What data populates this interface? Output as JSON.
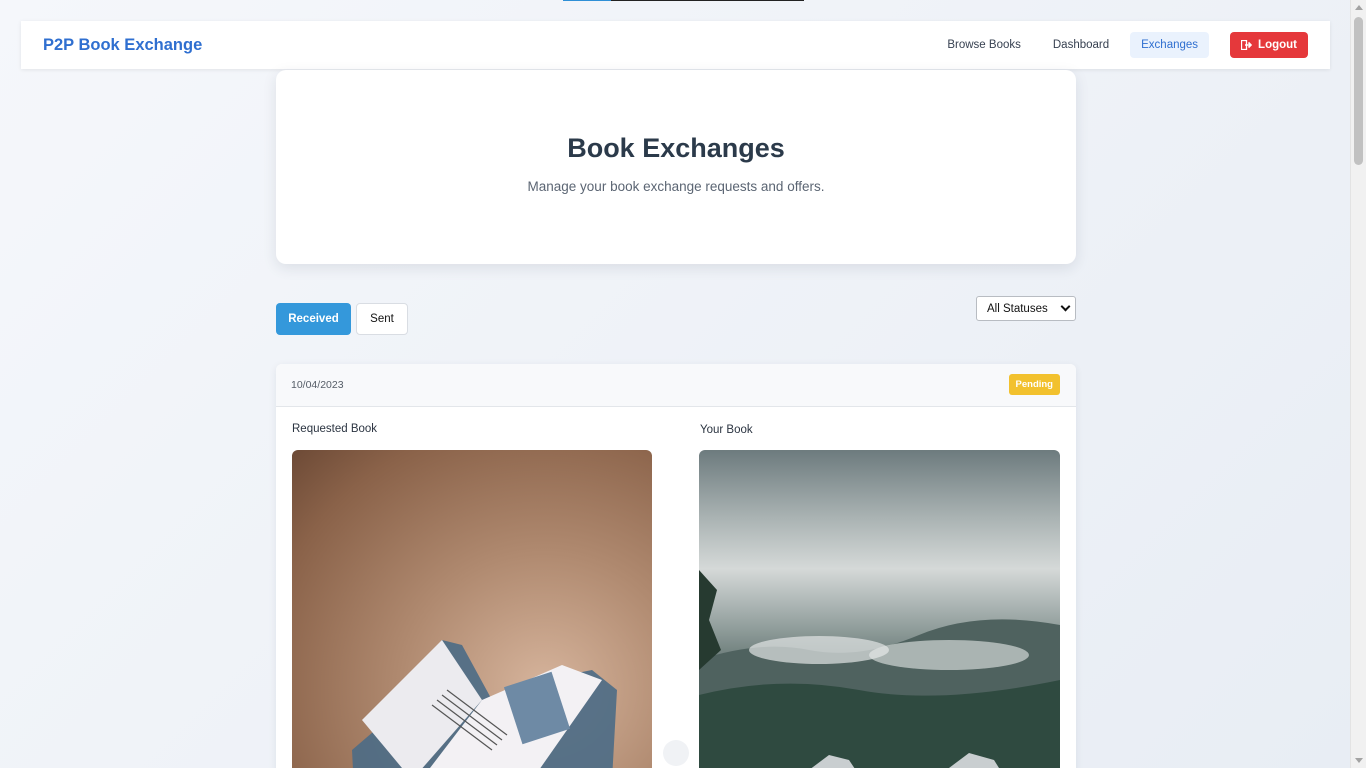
{
  "navbar": {
    "brand": "P2P Book Exchange",
    "links": [
      {
        "label": "Browse Books",
        "active": false
      },
      {
        "label": "Dashboard",
        "active": false
      },
      {
        "label": "Exchanges",
        "active": true
      }
    ],
    "logout_label": "Logout",
    "logout_icon": "sign-out-icon"
  },
  "hero": {
    "title": "Book Exchanges",
    "subtitle": "Manage your book exchange requests and offers."
  },
  "tabs": {
    "received": "Received",
    "sent": "Sent",
    "active": "received"
  },
  "filter": {
    "selected": "All Statuses"
  },
  "exchange_card": {
    "date": "10/04/2023",
    "status": "Pending",
    "requested_label": "Requested Book",
    "your_label": "Your Book"
  },
  "colors": {
    "brand": "#2f6fd0",
    "primary": "#3498db",
    "danger": "#e5383b",
    "pending": "#f2c12e"
  }
}
